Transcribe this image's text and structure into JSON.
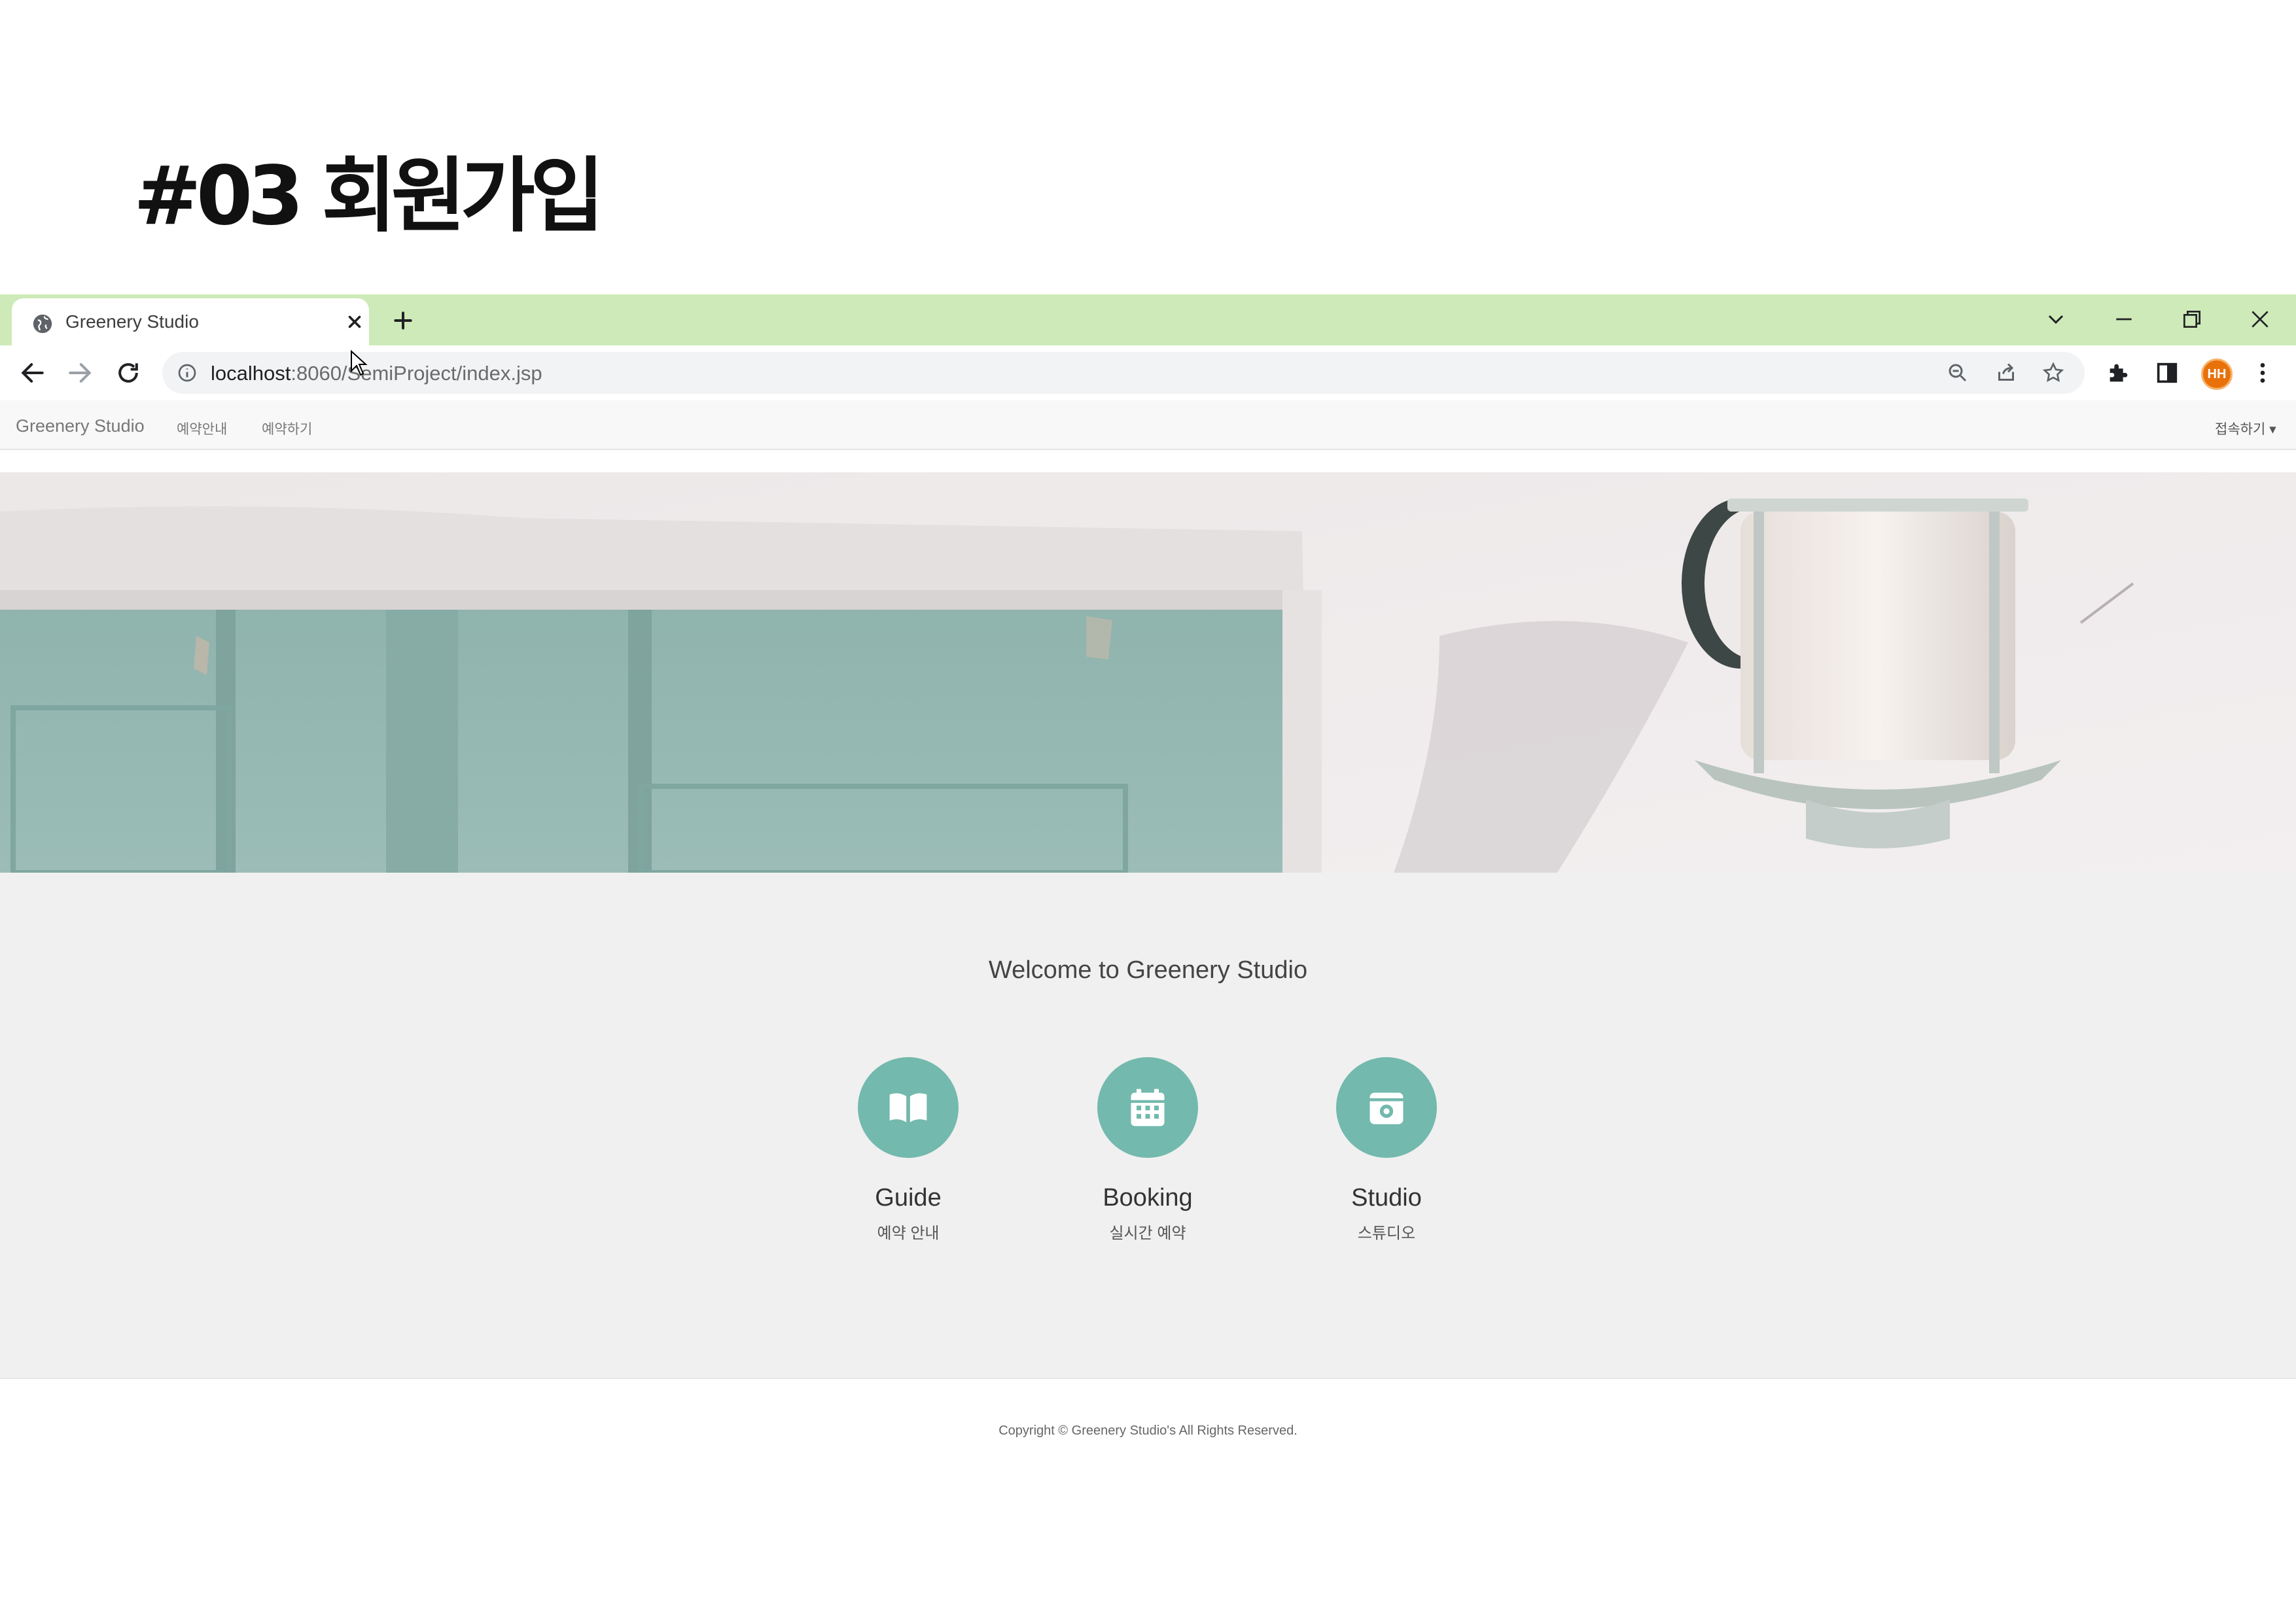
{
  "slide": {
    "title": "#03 회원가입"
  },
  "browser": {
    "tab": {
      "title": "Greenery Studio"
    },
    "address": {
      "host": "localhost",
      "path": ":8060/SemiProject/index.jsp"
    },
    "profile": {
      "initials": "HH"
    }
  },
  "site": {
    "nav": {
      "brand": "Greenery Studio",
      "links": [
        "예약안내",
        "예약하기"
      ],
      "right": "접속하기 ▾"
    },
    "welcome": "Welcome to Greenery Studio",
    "features": [
      {
        "title": "Guide",
        "subtitle": "예약 안내",
        "icon": "book-icon"
      },
      {
        "title": "Booking",
        "subtitle": "실시간 예약",
        "icon": "calendar-icon"
      },
      {
        "title": "Studio",
        "subtitle": "스튜디오",
        "icon": "camera-icon"
      }
    ],
    "footer": {
      "copyright": "Copyright © Greenery Studio's All Rights Reserved."
    }
  },
  "colors": {
    "tabbar": "#cdeab8",
    "accent": "#73b9ad",
    "avatar": "#e8710a"
  }
}
